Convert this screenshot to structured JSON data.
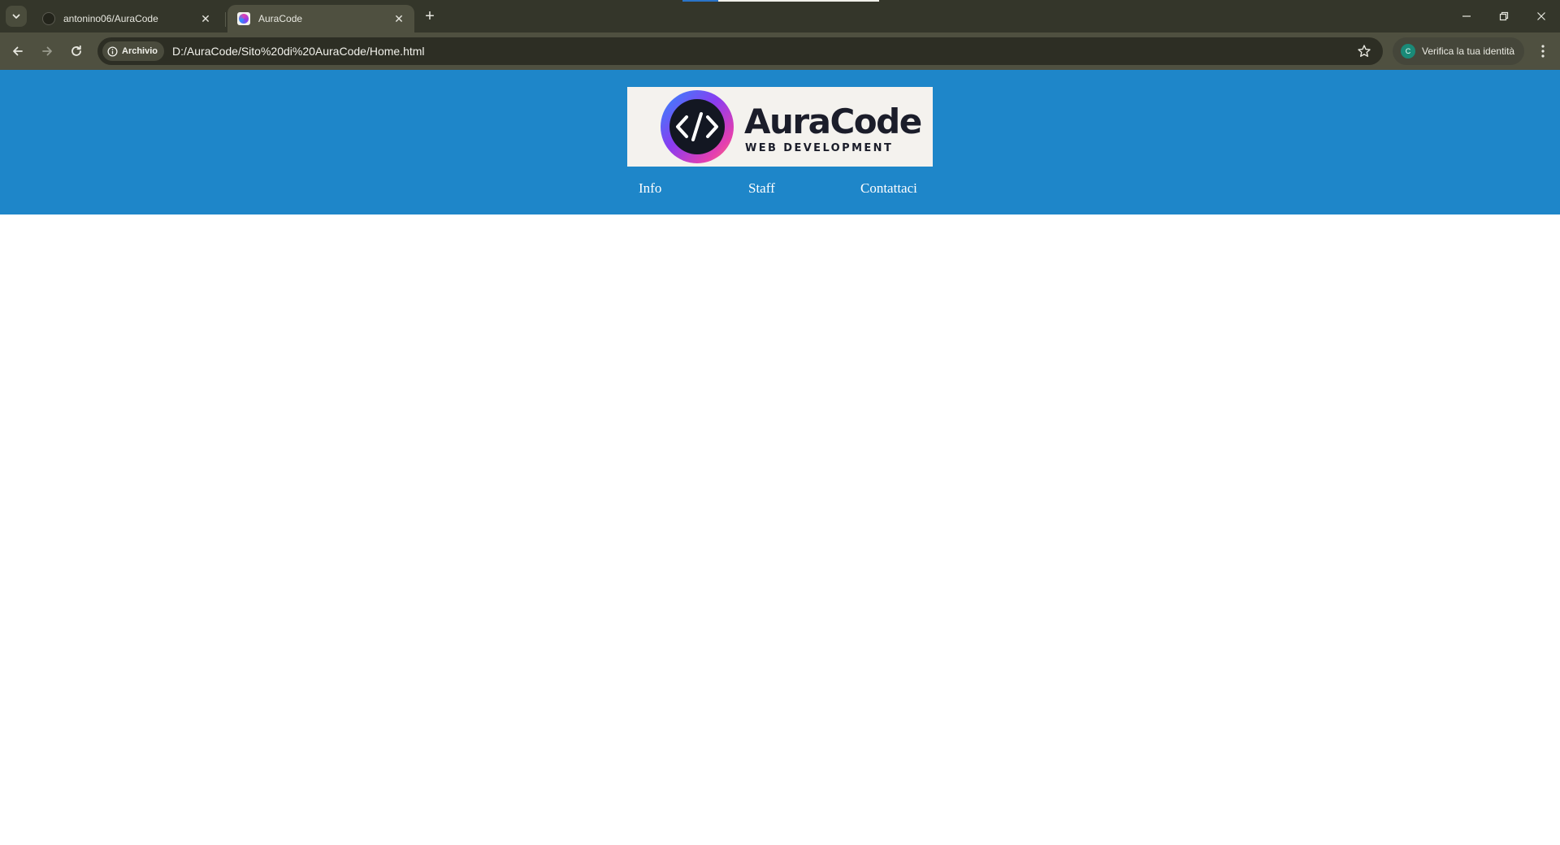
{
  "browser": {
    "tabs": [
      {
        "title": "antonino06/AuraCode",
        "favicon": "github-icon",
        "active": false
      },
      {
        "title": "AuraCode",
        "favicon": "auracode-favicon",
        "active": true
      }
    ],
    "page_load_progress": 0.18,
    "address_bar": {
      "security_chip": "Archivio",
      "url": "D:/AuraCode/Sito%20di%20AuraCode/Home.html"
    },
    "profile": {
      "avatar_letter": "C",
      "label": "Verifica la tua identità"
    }
  },
  "page": {
    "header_color": "#1e86c9",
    "logo": {
      "name": "AuraCode",
      "tagline": "WEB DEVELOPMENT"
    },
    "nav": {
      "items": [
        {
          "label": "Info"
        },
        {
          "label": "Staff"
        },
        {
          "label": "Contattaci"
        }
      ]
    }
  }
}
